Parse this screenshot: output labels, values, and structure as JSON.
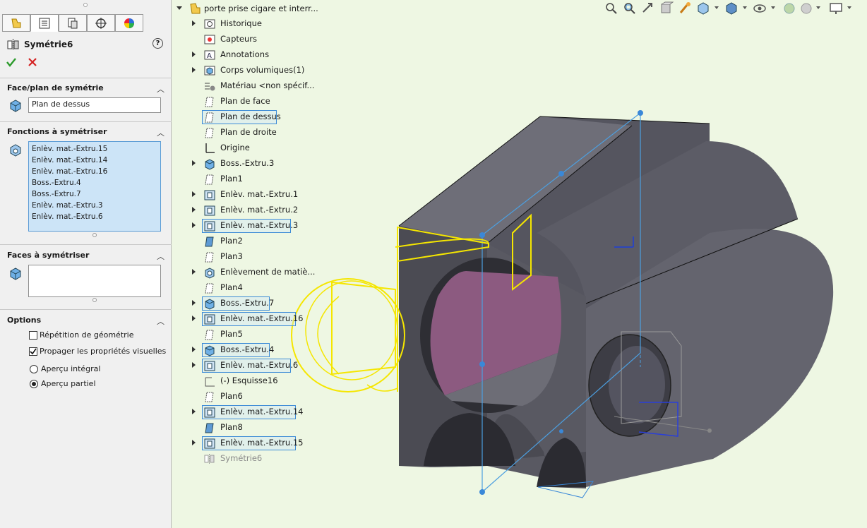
{
  "property_manager": {
    "tabs": [
      "feature-manager-tab",
      "property-manager-tab",
      "configuration-manager-tab",
      "dimxpert-tab",
      "display-manager-tab"
    ],
    "title": "Symétrie6",
    "help": "?",
    "sections": {
      "mirror_face": {
        "header": "Face/plan de symétrie",
        "value": "Plan de dessus"
      },
      "features": {
        "header": "Fonctions à symétriser",
        "items": [
          "Enlèv. mat.-Extru.15",
          "Enlèv. mat.-Extru.14",
          "Enlèv. mat.-Extru.16",
          "Boss.-Extru.4",
          "Boss.-Extru.7",
          "Enlèv. mat.-Extru.3",
          "Enlèv. mat.-Extru.6"
        ]
      },
      "faces": {
        "header": "Faces à symétriser",
        "value": ""
      },
      "options": {
        "header": "Options",
        "repeat_geometry": {
          "label": "Répétition de géométrie",
          "checked": false
        },
        "propagate_visual": {
          "label": "Propager les propriétés visuelles",
          "checked": true
        },
        "full_preview": {
          "label": "Aperçu intégral",
          "selected": false
        },
        "partial_preview": {
          "label": "Aperçu partiel",
          "selected": true
        }
      }
    }
  },
  "tree": {
    "root": "porte prise cigare et interr...",
    "items": [
      {
        "label": "Historique",
        "icon": "history-icon",
        "expandable": true,
        "selected": false
      },
      {
        "label": "Capteurs",
        "icon": "sensor-icon",
        "expandable": false,
        "selected": false
      },
      {
        "label": "Annotations",
        "icon": "annotation-icon",
        "expandable": true,
        "selected": false
      },
      {
        "label": "Corps volumiques(1)",
        "icon": "solid-bodies-icon",
        "expandable": true,
        "selected": false
      },
      {
        "label": "Matériau <non spécif...",
        "icon": "material-icon",
        "expandable": false,
        "selected": false
      },
      {
        "label": "Plan de face",
        "icon": "plane-icon",
        "expandable": false,
        "selected": false
      },
      {
        "label": "Plan de dessus",
        "icon": "plane-icon",
        "expandable": false,
        "selected": true
      },
      {
        "label": "Plan de droite",
        "icon": "plane-icon",
        "expandable": false,
        "selected": false
      },
      {
        "label": "Origine",
        "icon": "origin-icon",
        "expandable": false,
        "selected": false
      },
      {
        "label": "Boss.-Extru.3",
        "icon": "boss-extrude-icon",
        "expandable": true,
        "selected": false
      },
      {
        "label": "Plan1",
        "icon": "plane-icon",
        "expandable": false,
        "selected": false
      },
      {
        "label": "Enlèv. mat.-Extru.1",
        "icon": "cut-extrude-icon",
        "expandable": true,
        "selected": false
      },
      {
        "label": "Enlèv. mat.-Extru.2",
        "icon": "cut-extrude-icon",
        "expandable": true,
        "selected": false
      },
      {
        "label": "Enlèv. mat.-Extru.3",
        "icon": "cut-extrude-icon",
        "expandable": true,
        "selected": true
      },
      {
        "label": "Plan2",
        "icon": "plane-blue-icon",
        "expandable": false,
        "selected": false
      },
      {
        "label": "Plan3",
        "icon": "plane-icon",
        "expandable": false,
        "selected": false
      },
      {
        "label": "Enlèvement de matiè...",
        "icon": "cut-revolve-icon",
        "expandable": true,
        "selected": false
      },
      {
        "label": "Plan4",
        "icon": "plane-icon",
        "expandable": false,
        "selected": false
      },
      {
        "label": "Boss.-Extru.7",
        "icon": "boss-extrude-icon",
        "expandable": true,
        "selected": true
      },
      {
        "label": "Enlèv. mat.-Extru.16",
        "icon": "cut-extrude-icon",
        "expandable": true,
        "selected": true
      },
      {
        "label": "Plan5",
        "icon": "plane-icon",
        "expandable": false,
        "selected": false
      },
      {
        "label": "Boss.-Extru.4",
        "icon": "boss-extrude-icon",
        "expandable": true,
        "selected": true
      },
      {
        "label": "Enlèv. mat.-Extru.6",
        "icon": "cut-extrude-icon",
        "expandable": true,
        "selected": true
      },
      {
        "label": "(-) Esquisse16",
        "icon": "sketch-icon",
        "expandable": false,
        "selected": false
      },
      {
        "label": "Plan6",
        "icon": "plane-icon",
        "expandable": false,
        "selected": false
      },
      {
        "label": "Enlèv. mat.-Extru.14",
        "icon": "cut-extrude-icon",
        "expandable": true,
        "selected": true
      },
      {
        "label": "Plan8",
        "icon": "plane-blue-icon",
        "expandable": false,
        "selected": false
      },
      {
        "label": "Enlèv. mat.-Extru.15",
        "icon": "cut-extrude-icon",
        "expandable": true,
        "selected": true
      },
      {
        "label": "Symétrie6",
        "icon": "mirror-icon",
        "expandable": false,
        "selected": false,
        "dim": true
      }
    ]
  },
  "toolbar": {
    "icons": [
      "zoom-to-fit-icon",
      "zoom-to-area-icon",
      "previous-view-icon",
      "section-view-icon",
      "dynamic-annotation-icon",
      "view-orientation-icon",
      "display-style-icon",
      "hide-show-icon",
      "edit-appearance-icon",
      "apply-scene-icon",
      "view-settings-icon"
    ]
  },
  "colors": {
    "background": "#eef7e3",
    "panel": "#f0f0f0",
    "selection_border": "#3d8bd6",
    "listbox": "#cce4f7",
    "preview_yellow": "#f5e600",
    "part_dark": "#4f4f58",
    "cut_face": "#8a5a7e"
  }
}
